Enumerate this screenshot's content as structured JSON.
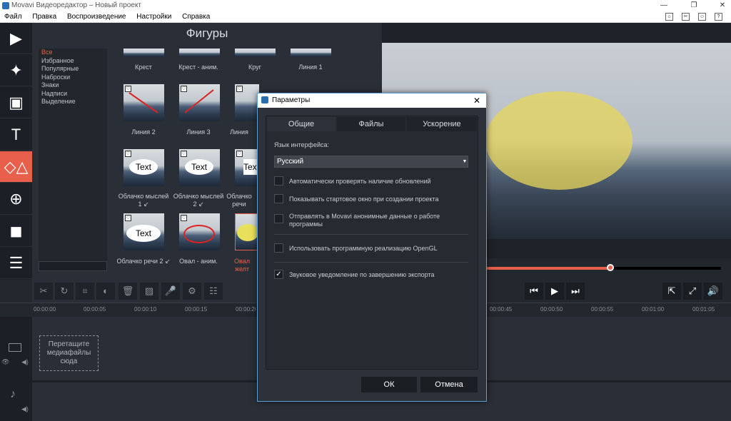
{
  "app": {
    "title": "Movavi Видеоредактор – Новый проект"
  },
  "menu": [
    "Файл",
    "Правка",
    "Воспроизведение",
    "Настройки",
    "Справка"
  ],
  "shapes_panel": {
    "title": "Фигуры",
    "categories": [
      "Все",
      "Избранное",
      "Популярные",
      "Наброски",
      "Знаки",
      "Надписи",
      "Выделение"
    ],
    "items_row0": [
      "Крест",
      "Крест - аним.",
      "Круг",
      "Линия 1"
    ],
    "items_row1": [
      "Линия 2",
      "Линия 3",
      "Линия"
    ],
    "items_row2": [
      "Облачко мыслей 1 ↙",
      "Облачко мыслей 2 ↙",
      "Облачко речи"
    ],
    "items_row3": [
      "Облачко речи 2 ↙",
      "Овал - аним.",
      "Овал желт"
    ],
    "bubble_text": "Text"
  },
  "timeline": {
    "ticks": [
      "00:00:00",
      "00:00:05",
      "00:00:10",
      "00:00:15",
      "00:00:20",
      "00:00:45",
      "00:00:50",
      "00:00:55",
      "00:01:00",
      "00:01:05"
    ],
    "drop_hint": "Перетащите медиафайлы сюда"
  },
  "dialog": {
    "title": "Параметры",
    "tabs": [
      "Общие",
      "Файлы",
      "Ускорение"
    ],
    "language_label": "Язык интерфейса:",
    "language_value": "Русский",
    "options": [
      {
        "label": "Автоматически проверять наличие обновлений",
        "checked": false
      },
      {
        "label": "Показывать стартовое окно при создании проекта",
        "checked": false
      },
      {
        "label": "Отправлять в Movavi анонимные данные о работе программы",
        "checked": false
      },
      {
        "label": "Использовать программную реализацию OpenGL",
        "checked": false
      },
      {
        "label": "Звуковое уведомление по завершению экспорта",
        "checked": true
      }
    ],
    "ok_label": "ОК",
    "cancel_label": "Отмена"
  },
  "player": {
    "progress": 0.53
  },
  "colors": {
    "accent": "#e8604b",
    "ellipse": "#e8d65a"
  }
}
